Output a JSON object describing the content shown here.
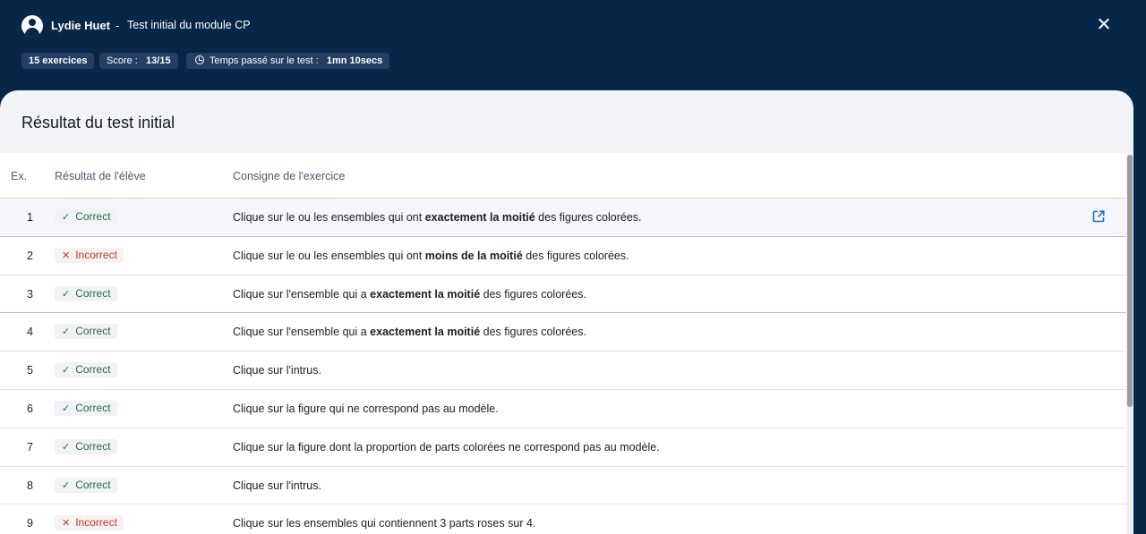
{
  "header": {
    "student_name": "Lydie Huet",
    "separator": "-",
    "module_title": "Test initial du module CP",
    "chips": {
      "exercises": "15 exercices",
      "score_label": "Score :",
      "score_value": "13/15",
      "time_label": "Temps passé sur le test :",
      "time_value": "1mn 10secs"
    }
  },
  "panel": {
    "title": "Résultat du test initial"
  },
  "table": {
    "headers": {
      "ex": "Ex.",
      "result": "Résultat de l'élève",
      "instruction": "Consigne de l'exercice"
    },
    "rows": [
      {
        "num": "1",
        "status": "Correct",
        "instr": [
          "Clique sur le ou les ensembles qui ont ",
          "exactement la moitié",
          " des figures colorées."
        ]
      },
      {
        "num": "2",
        "status": "Incorrect",
        "instr": [
          "Clique sur le ou les ensembles qui ont ",
          "moins de la moitié",
          " des figures colorées."
        ]
      },
      {
        "num": "3",
        "status": "Correct",
        "instr": [
          "Clique sur l'ensemble qui a ",
          "exactement la moitié",
          " des figures colorées."
        ]
      },
      {
        "num": "4",
        "status": "Correct",
        "instr": [
          "Clique sur l'ensemble qui a ",
          "exactement la moitié",
          " des figures colorées."
        ]
      },
      {
        "num": "5",
        "status": "Correct",
        "instr": [
          "Clique sur l'intrus.",
          "",
          ""
        ]
      },
      {
        "num": "6",
        "status": "Correct",
        "instr": [
          "Clique sur la figure qui ne correspond pas au modèle.",
          "",
          ""
        ]
      },
      {
        "num": "7",
        "status": "Correct",
        "instr": [
          "Clique sur la figure dont la proportion de parts colorées ne correspond pas au modèle.",
          "",
          ""
        ]
      },
      {
        "num": "8",
        "status": "Correct",
        "instr": [
          "Clique sur l'intrus.",
          "",
          ""
        ]
      },
      {
        "num": "9",
        "status": "Incorrect",
        "instr": [
          "Clique sur les ensembles qui contiennent 3 parts roses sur 4.",
          "",
          ""
        ]
      }
    ]
  },
  "colors": {
    "header_bg": "#082748",
    "correct": "#2d6a44",
    "incorrect": "#c0392b",
    "accent": "#1f6fd0"
  }
}
